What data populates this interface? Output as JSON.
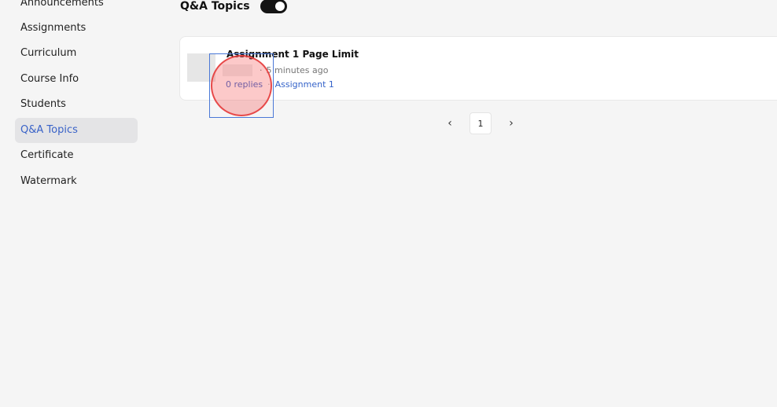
{
  "sidebar": {
    "items": [
      {
        "label": "Announcements"
      },
      {
        "label": "Assignments"
      },
      {
        "label": "Curriculum"
      },
      {
        "label": "Course Info"
      },
      {
        "label": "Students"
      },
      {
        "label": "Q&A Topics",
        "active": true
      },
      {
        "label": "Certificate"
      },
      {
        "label": "Watermark"
      }
    ]
  },
  "header": {
    "title": "Q&A Topics",
    "toggle_on": true
  },
  "topics": [
    {
      "title": "Assignment 1 Page Limit",
      "time": "5 minutes ago",
      "meta_separator": "·",
      "replies": "0 replies",
      "link_separator": "·",
      "assignment": "Assignment 1"
    }
  ],
  "pagination": {
    "prev": "‹",
    "current_page": "1",
    "next": "›"
  },
  "colors": {
    "accent": "#3563c9",
    "active_nav_bg": "#e4e4e6",
    "toggle_bg": "#141414",
    "click_marker": "#f05858"
  }
}
